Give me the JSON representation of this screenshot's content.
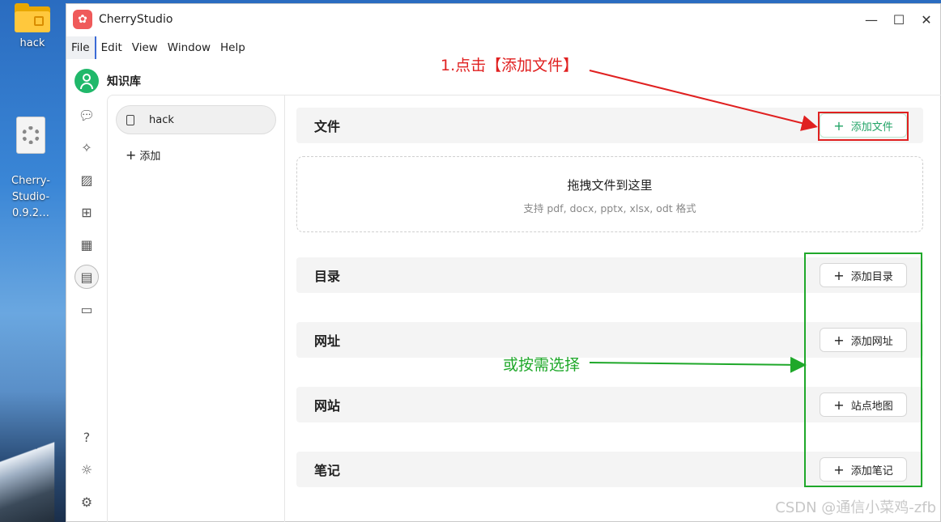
{
  "desktop": {
    "icons": [
      {
        "label": "hack"
      },
      {
        "label": "Cherry-\nStudio-0.9.2…"
      }
    ]
  },
  "window": {
    "title": "CherryStudio",
    "logo_glyph": "✿",
    "controls": {
      "minimize": "—",
      "maximize": "☐",
      "close": "✕"
    }
  },
  "menu": [
    "File",
    "Edit",
    "View",
    "Window",
    "Help"
  ],
  "kb_header": {
    "title": "知识库"
  },
  "knowledge_list": {
    "items": [
      {
        "label": "hack"
      }
    ],
    "add_label": "添加"
  },
  "content": {
    "file_section": {
      "title": "文件",
      "button": "添加文件"
    },
    "dropzone": {
      "title": "拖拽文件到这里",
      "subtitle": "支持 pdf, docx, pptx, xlsx, odt 格式"
    },
    "dir_section": {
      "title": "目录",
      "button": "添加目录"
    },
    "url_section": {
      "title": "网址",
      "button": "添加网址"
    },
    "site_section": {
      "title": "网站",
      "button": "站点地图"
    },
    "note_section": {
      "title": "笔记",
      "button": "添加笔记"
    }
  },
  "annotations": {
    "red_text": "1.点击【添加文件】",
    "green_text": "或按需选择"
  },
  "watermark": "CSDN @通信小菜鸡-zfb",
  "colors": {
    "accent_green": "#21a366",
    "annotation_red": "#e02020",
    "annotation_green": "#1fa82a",
    "logo_red": "#ef5a5a"
  }
}
